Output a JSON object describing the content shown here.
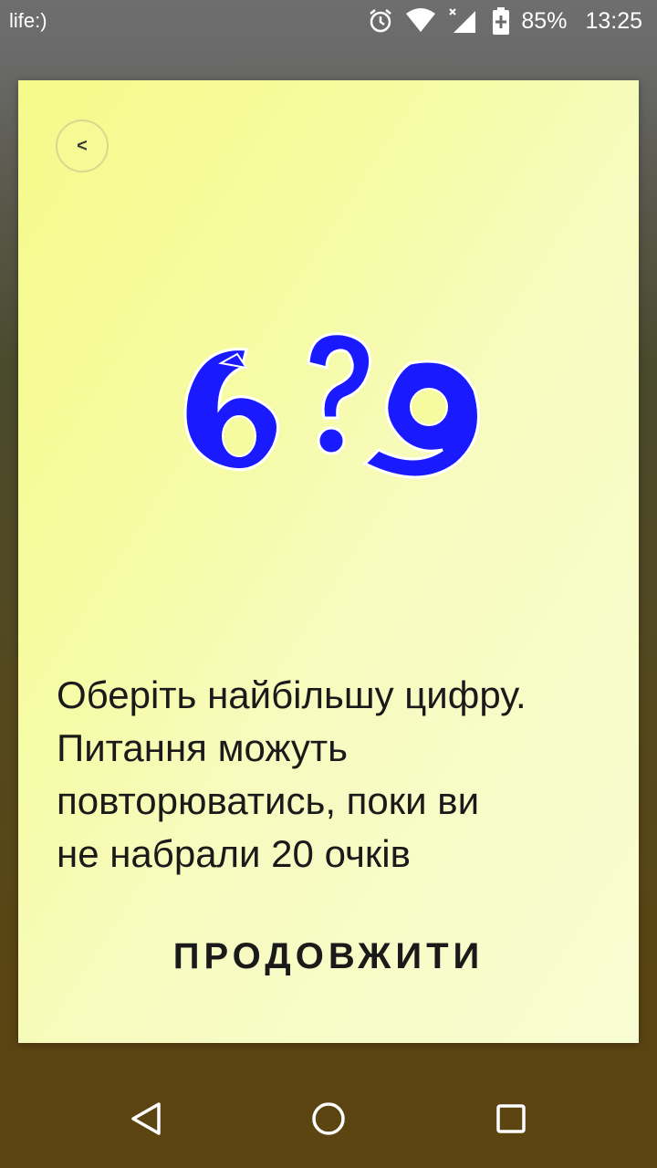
{
  "status_bar": {
    "carrier": "life:)",
    "battery_percent": "85%",
    "time": "13:25",
    "icons": [
      "alarm-icon",
      "wifi-icon",
      "signal-icon",
      "battery-icon"
    ]
  },
  "card": {
    "back_button": {
      "label": "<",
      "icon": "chevron-left-icon"
    },
    "illustration": {
      "left_digit": "6",
      "middle_symbol": "?",
      "right_digit": "9",
      "color": "#1a1aff"
    },
    "instructions": "Оберіть найбільшу цифру.\nПитання можуть\nповторюватись, поки ви\nне набрали 20 очків",
    "continue_label": "ПРОДОВЖИТИ"
  },
  "nav_bar": {
    "icons": [
      "back-triangle-icon",
      "home-circle-icon",
      "recents-square-icon"
    ]
  },
  "colors": {
    "card_background": "#f6fba0",
    "illustration_blue": "#1a1aff",
    "text": "#1a1a1a"
  }
}
